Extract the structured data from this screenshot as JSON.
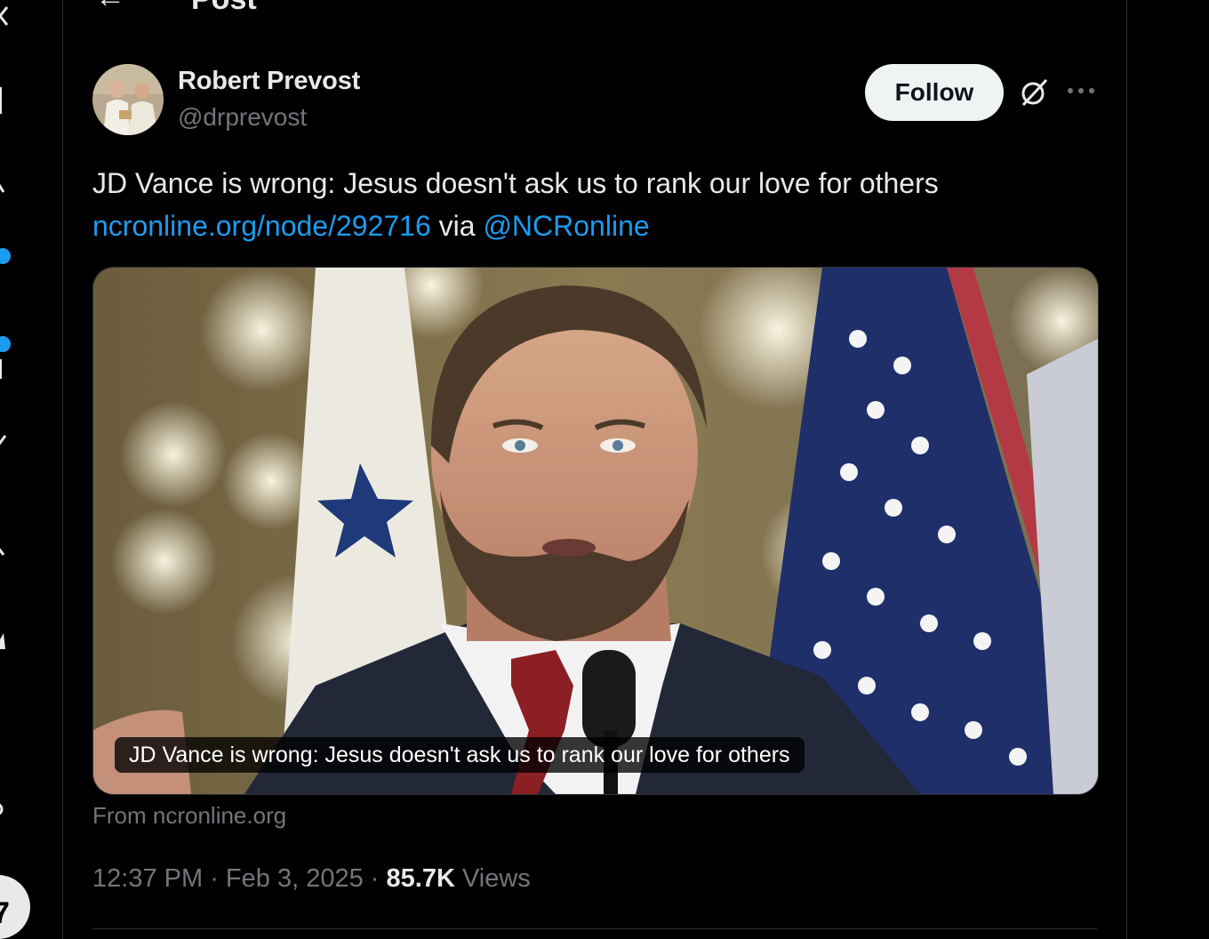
{
  "header": {
    "back_glyph": "←",
    "title": "Post"
  },
  "post": {
    "author": {
      "name": "Robert Prevost",
      "handle": "@drprevost"
    },
    "follow_label": "Follow",
    "text": {
      "line1": "JD Vance is wrong: Jesus doesn't ask us to rank our love for others",
      "link": "ncronline.org/node/292716",
      "via": " via ",
      "mention": "@NCRonline"
    },
    "card": {
      "caption": "JD Vance is wrong: Jesus doesn't ask us to rank our love for others",
      "source": "From ncronline.org"
    },
    "meta": {
      "time": "12:37 PM",
      "separator": " · ",
      "date": "Feb 3, 2025",
      "views_count": "85.7K",
      "views_label": " Views"
    }
  },
  "icons": {
    "grok": "grok-icon",
    "more": "more-options-icon",
    "back": "back-arrow-icon"
  },
  "colors": {
    "background": "#000000",
    "text": "#e7e9ea",
    "muted": "#71767b",
    "link": "#1d9bf0",
    "follow_bg": "#eff3f4",
    "border": "#2f3336"
  }
}
